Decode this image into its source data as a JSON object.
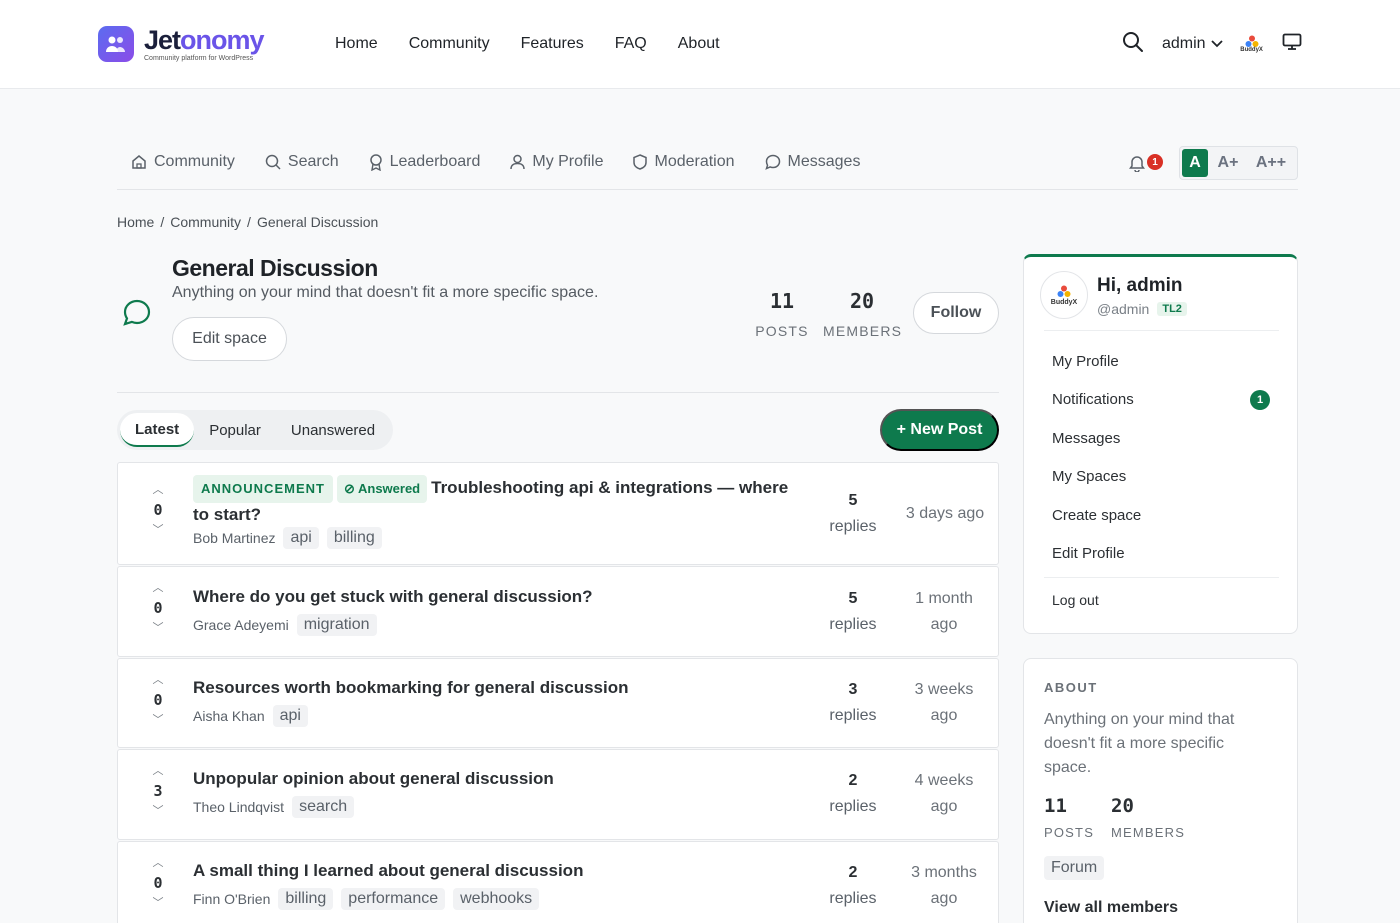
{
  "topbar": {
    "logo_name_a": "Jet",
    "logo_name_b": "onomy",
    "logo_tagline": "Community platform for WordPress",
    "nav": [
      "Home",
      "Community",
      "Features",
      "FAQ",
      "About"
    ],
    "user": "admin",
    "buddyx_text": "BuddyX"
  },
  "subnav": {
    "items": [
      "Community",
      "Search",
      "Leaderboard",
      "My Profile",
      "Moderation",
      "Messages"
    ],
    "notif_count": "1",
    "font_sizes": [
      "A",
      "A+",
      "A++"
    ]
  },
  "breadcrumb": [
    "Home",
    "/",
    "Community",
    "/",
    "General Discussion"
  ],
  "space": {
    "title": "General Discussion",
    "description": "Anything on your mind that doesn't fit a more specific space.",
    "edit_label": "Edit space",
    "posts": "11",
    "posts_label": "POSTS",
    "members": "20",
    "members_label": "MEMBERS",
    "follow_label": "Follow"
  },
  "tabs": [
    "Latest",
    "Popular",
    "Unanswered"
  ],
  "new_post_label": "+ New Post",
  "posts": [
    {
      "badge_announcement": "ANNOUNCEMENT",
      "badge_answered": "Answered",
      "title": "Troubleshooting api & integrations — where to start?",
      "votes": "0",
      "author": "Bob Martinez",
      "tags": [
        "api",
        "billing"
      ],
      "replies": "5",
      "replies_label": "replies",
      "time": "3 days ago"
    },
    {
      "title": "Where do you get stuck with general discussion?",
      "votes": "0",
      "author": "Grace Adeyemi",
      "tags": [
        "migration"
      ],
      "replies": "5",
      "replies_label": "replies",
      "time": "1 month ago"
    },
    {
      "title": "Resources worth bookmarking for general discussion",
      "votes": "0",
      "author": "Aisha Khan",
      "tags": [
        "api"
      ],
      "replies": "3",
      "replies_label": "replies",
      "time": "3 weeks ago"
    },
    {
      "title": "Unpopular opinion about general discussion",
      "votes": "3",
      "author": "Theo Lindqvist",
      "tags": [
        "search"
      ],
      "replies": "2",
      "replies_label": "replies",
      "time": "4 weeks ago"
    },
    {
      "title": "A small thing I learned about general discussion",
      "votes": "0",
      "author": "Finn O'Brien",
      "tags": [
        "billing",
        "performance",
        "webhooks"
      ],
      "replies": "2",
      "replies_label": "replies",
      "time": "3 months ago"
    }
  ],
  "user_card": {
    "greeting": "Hi, admin",
    "handle": "@admin",
    "trust_level": "TL2",
    "avatar_text": "BuddyX",
    "menu": [
      "My Profile",
      "Notifications",
      "Messages",
      "My Spaces",
      "Create space",
      "Edit Profile"
    ],
    "notif_count": "1",
    "logout": "Log out"
  },
  "about_card": {
    "heading": "ABOUT",
    "description": "Anything on your mind that doesn't fit a more specific space.",
    "posts": "11",
    "posts_label": "POSTS",
    "members": "20",
    "members_label": "MEMBERS",
    "tag": "Forum",
    "view_all": "View all members"
  },
  "colors": {
    "accent": "#0e7a4d",
    "badge_red": "#d93025",
    "logo_gradient_start": "#5b6cf0",
    "logo_gradient_end": "#8b4ce8"
  }
}
